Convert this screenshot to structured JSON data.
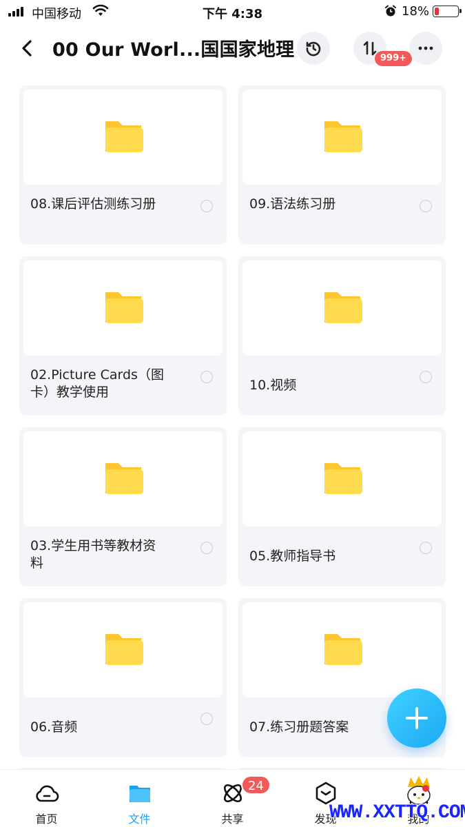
{
  "status_bar": {
    "carrier": "中国移动",
    "time": "下午 4:38",
    "battery_percent": "18%",
    "battery_level": 0.18,
    "battery_color": "#e8333a"
  },
  "header": {
    "title": "00 Our Worl...国国家地理",
    "back_icon": "chevron-left-icon",
    "history_icon": "history-icon",
    "transfer_icon": "transfer-icon",
    "transfer_badge": "999+",
    "more_icon": "more-icon"
  },
  "folders": [
    {
      "name": "08.课后评估测练习册",
      "icon": "folder-icon"
    },
    {
      "name": "09.语法练习册",
      "icon": "folder-icon"
    },
    {
      "name": "02.Picture Cards（图卡）教学使用",
      "icon": "folder-icon"
    },
    {
      "name": "10.视频",
      "icon": "folder-icon"
    },
    {
      "name": "03.学生用书等教材资料",
      "icon": "folder-icon"
    },
    {
      "name": "05.教师指导书",
      "icon": "folder-icon"
    },
    {
      "name": "06.音频",
      "icon": "folder-icon"
    },
    {
      "name": "07.练习册题答案",
      "icon": "folder-icon"
    }
  ],
  "fab": {
    "icon": "plus-icon",
    "color": "#1ca8f5"
  },
  "tabbar": {
    "tabs": [
      {
        "label": "首页",
        "icon": "cloud-icon"
      },
      {
        "label": "文件",
        "icon": "folder-icon"
      },
      {
        "label": "共享",
        "icon": "atom-icon",
        "badge": "24"
      },
      {
        "label": "发现",
        "icon": "discover-icon"
      },
      {
        "label": "我的",
        "icon": "profile-icon"
      }
    ],
    "active_color": "#1ea0f0"
  },
  "watermark": {
    "text": "WWW.XXTTQ.COM",
    "color": "#1a25ff"
  }
}
